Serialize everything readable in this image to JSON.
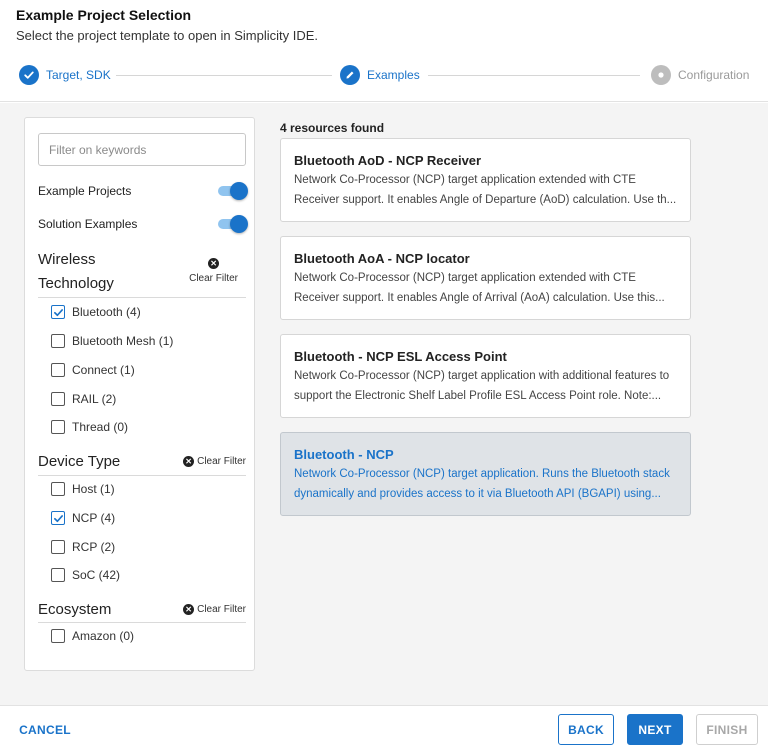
{
  "header": {
    "title": "Example Project Selection",
    "subtitle": "Select the project template to open in Simplicity IDE."
  },
  "stepper": {
    "steps": [
      {
        "label": "Target, SDK",
        "state": "done"
      },
      {
        "label": "Examples",
        "state": "active"
      },
      {
        "label": "Configuration",
        "state": "pending"
      }
    ]
  },
  "filters": {
    "search_placeholder": "Filter on keywords",
    "search_value": "",
    "toggles": [
      {
        "label": "Example Projects",
        "on": true
      },
      {
        "label": "Solution Examples",
        "on": true
      }
    ],
    "clear_label": "Clear Filter",
    "sections": [
      {
        "title_line1": "Wireless",
        "title_line2": "Technology",
        "options": [
          {
            "label": "Bluetooth (4)",
            "checked": true
          },
          {
            "label": "Bluetooth Mesh (1)",
            "checked": false
          },
          {
            "label": "Connect (1)",
            "checked": false
          },
          {
            "label": "RAIL (2)",
            "checked": false
          },
          {
            "label": "Thread (0)",
            "checked": false
          }
        ]
      },
      {
        "title": "Device Type",
        "options": [
          {
            "label": "Host (1)",
            "checked": false
          },
          {
            "label": "NCP (4)",
            "checked": true
          },
          {
            "label": "RCP (2)",
            "checked": false
          },
          {
            "label": "SoC (42)",
            "checked": false
          }
        ]
      },
      {
        "title": "Ecosystem",
        "options": [
          {
            "label": "Amazon (0)",
            "checked": false
          }
        ]
      }
    ]
  },
  "results": {
    "count_label": "4 resources found",
    "cards": [
      {
        "title": "Bluetooth AoD - NCP Receiver",
        "description": "Network Co-Processor (NCP) target application extended with CTE Receiver support. It enables Angle of Departure (AoD) calculation. Use th...",
        "selected": false
      },
      {
        "title": "Bluetooth AoA - NCP locator",
        "description": "Network Co-Processor (NCP) target application extended with CTE Receiver support. It enables Angle of Arrival (AoA) calculation. Use this...",
        "selected": false
      },
      {
        "title": "Bluetooth - NCP ESL Access Point",
        "description": "Network Co-Processor (NCP) target application with additional features to support the Electronic Shelf Label Profile ESL Access Point role. Note:...",
        "selected": false
      },
      {
        "title": "Bluetooth - NCP",
        "description": "Network Co-Processor (NCP) target application. Runs the Bluetooth stack dynamically and provides access to it via Bluetooth API (BGAPI) using...",
        "selected": true
      }
    ]
  },
  "footer": {
    "cancel": "CANCEL",
    "back": "BACK",
    "next": "NEXT",
    "finish": "FINISH"
  },
  "colors": {
    "accent": "#1a73c9",
    "selected_card_bg": "#dfe3e7",
    "disabled": "#a8a8a8"
  }
}
